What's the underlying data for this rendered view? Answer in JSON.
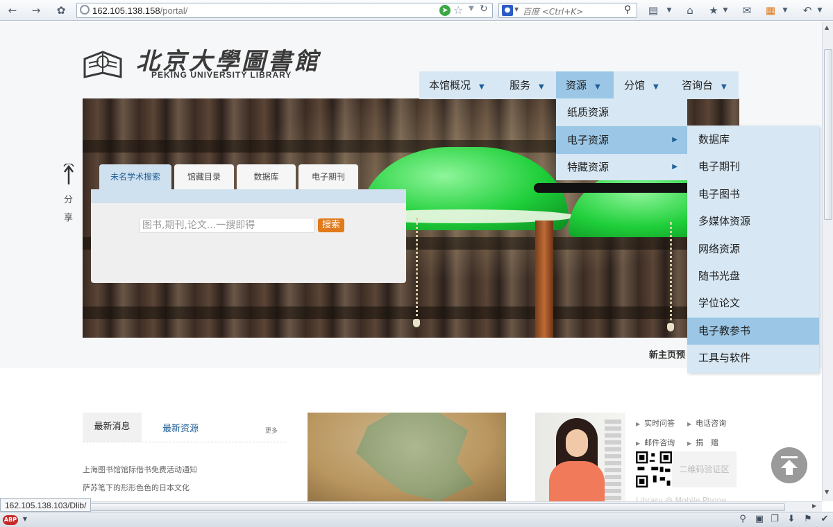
{
  "browser": {
    "address_host": "162.105.138.158",
    "address_path": "/portal/",
    "search_engine": "百度",
    "search_placeholder": "<Ctrl+K>",
    "status_url": "162.105.138.103/Dlib/",
    "abp_label": "ABP"
  },
  "logo": {
    "name_cn": "北京大學圖書館",
    "name_en": "PEKING UNIVERSITY LIBRARY"
  },
  "nav": {
    "items": [
      {
        "label": "本馆概况"
      },
      {
        "label": "服务"
      },
      {
        "label": "资源"
      },
      {
        "label": "分馆"
      },
      {
        "label": "咨询台"
      }
    ]
  },
  "resources_menu": {
    "items": [
      {
        "label": "纸质资源"
      },
      {
        "label": "电子资源"
      },
      {
        "label": "特藏资源"
      }
    ]
  },
  "e_resources_menu": {
    "items": [
      {
        "label": "数据库"
      },
      {
        "label": "电子期刊"
      },
      {
        "label": "电子图书"
      },
      {
        "label": "多媒体资源"
      },
      {
        "label": "网络资源"
      },
      {
        "label": "随书光盘"
      },
      {
        "label": "学位论文"
      },
      {
        "label": "电子教参书"
      },
      {
        "label": "工具与软件"
      }
    ]
  },
  "search": {
    "tabs": [
      {
        "label": "未名学术搜索"
      },
      {
        "label": "馆藏目录"
      },
      {
        "label": "数据库"
      },
      {
        "label": "电子期刊"
      }
    ],
    "placeholder": "图书,期刊,论文...一搜即得",
    "button": "搜索"
  },
  "share": {
    "line1": "分",
    "line2": "享"
  },
  "new_home": "新主页预",
  "news": {
    "tab_latest": "最新消息",
    "tab_resources": "最新资源",
    "more": "更多",
    "items": [
      {
        "title": "上海图书馆馆际借书免费活动通知"
      },
      {
        "title": "萨苏笔下的形形色色的日本文化"
      }
    ]
  },
  "services": {
    "items": [
      {
        "label": "实时问答"
      },
      {
        "label": "电话咨询"
      },
      {
        "label": "邮件咨询"
      },
      {
        "label": "捐　赠"
      }
    ],
    "qr_label": "二维码验证区",
    "mobile": "Library @ Mobile Phone"
  },
  "colors": {
    "nav_bg": "#d7e7f3",
    "nav_active": "#9bc6e6",
    "search_button": "#e07a1a"
  }
}
